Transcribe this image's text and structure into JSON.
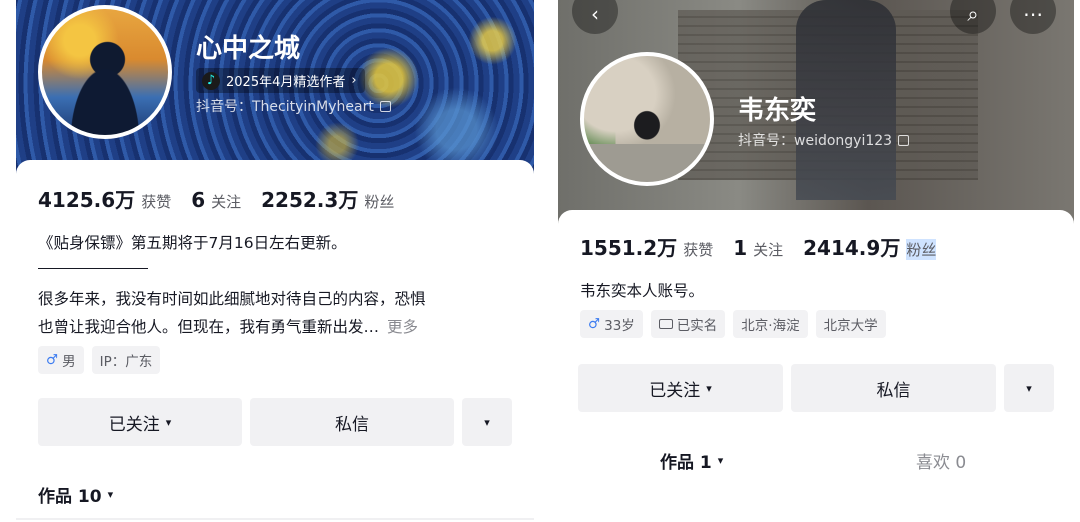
{
  "left": {
    "username": "心中之城",
    "badge": "2025年4月精选作者",
    "badge_chevron": "›",
    "douyin_id": "抖音号：ThecityinMyheart",
    "stats": [
      {
        "value": "4125.6万",
        "label": "获赞"
      },
      {
        "value": "6",
        "label": "关注"
      },
      {
        "value": "2252.3万",
        "label": "粉丝"
      }
    ],
    "announcement": "《贴身保镖》第五期将于7月16日左右更新。",
    "bio_line1": "很多年来，我没有时间如此细腻地对待自己的内容，恐惧",
    "bio_line2": "也曾让我迎合他人。但现在，我有勇气重新出发…",
    "more": "更多",
    "tags": [
      {
        "icon": "♂",
        "text": "男"
      },
      {
        "icon": "",
        "text": "IP：广东"
      }
    ],
    "buttons": {
      "followed": "已关注",
      "message": "私信",
      "caret": "▾"
    },
    "works_tab": "作品 10"
  },
  "right": {
    "username": "韦东奕",
    "douyin_id": "抖音号：weidongyi123",
    "stats": [
      {
        "value": "1551.2万",
        "label": "获赞"
      },
      {
        "value": "1",
        "label": "关注"
      },
      {
        "value": "2414.9万",
        "label": "粉丝"
      }
    ],
    "bio": "韦东奕本人账号。",
    "tags": [
      {
        "icon": "♂",
        "text": "33岁"
      },
      {
        "icon": "id-card",
        "text": "已实名"
      },
      {
        "icon": "",
        "text": "北京·海淀"
      },
      {
        "icon": "",
        "text": "北京大学"
      }
    ],
    "buttons": {
      "followed": "已关注",
      "message": "私信",
      "caret": "▾"
    },
    "works_tab": "作品 1",
    "likes_tab": "喜欢 0"
  },
  "colors": {
    "male_icon": "#3d7cf0",
    "button_bg": "#f1f1f3",
    "muted_text": "#5b5c63"
  },
  "icons": [
    "douyin-logo-icon",
    "copy-icon",
    "male-icon",
    "id-card-icon",
    "back-icon",
    "search-icon",
    "more-icon"
  ]
}
